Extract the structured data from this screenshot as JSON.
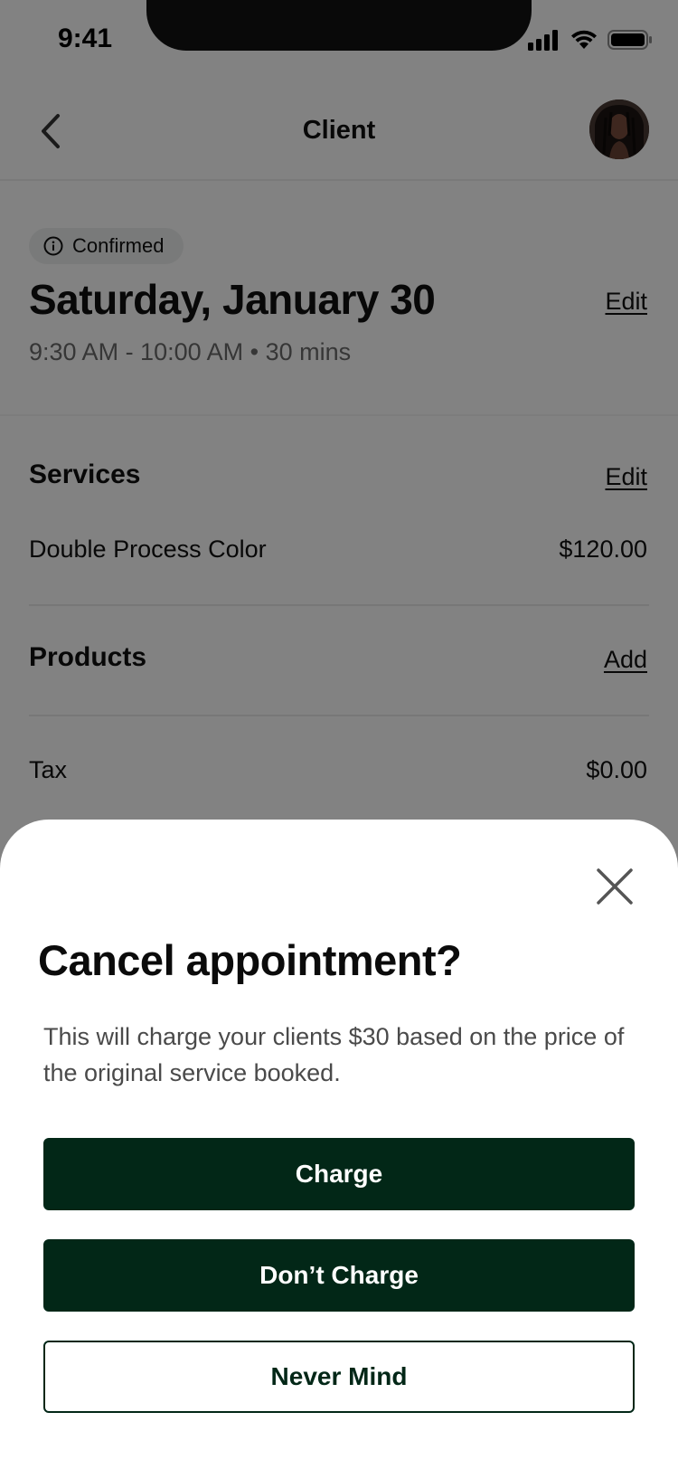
{
  "status_bar": {
    "time": "9:41"
  },
  "nav": {
    "title": "Client"
  },
  "appointment": {
    "status": "Confirmed",
    "date": "Saturday, January 30",
    "edit_label": "Edit",
    "time_range": "9:30 AM - 10:00 AM • 30 mins"
  },
  "services": {
    "heading": "Services",
    "edit_label": "Edit",
    "items": [
      {
        "name": "Double Process Color",
        "price": "$120.00"
      }
    ]
  },
  "products": {
    "heading": "Products",
    "add_label": "Add"
  },
  "tax": {
    "label": "Tax",
    "value": "$0.00"
  },
  "modal": {
    "title": "Cancel appointment?",
    "body": "This will charge your clients $30 based on the price of the original service booked.",
    "charge_label": "Charge",
    "dont_charge_label": "Don’t Charge",
    "never_mind_label": "Never Mind"
  },
  "colors": {
    "primary": "#022717",
    "overlay": "rgba(0,0,0,0.49)"
  },
  "icons": {
    "back": "chevron-left-icon",
    "info": "info-icon",
    "close": "close-icon",
    "signal": "signal-icon",
    "wifi": "wifi-icon",
    "battery": "battery-icon"
  }
}
